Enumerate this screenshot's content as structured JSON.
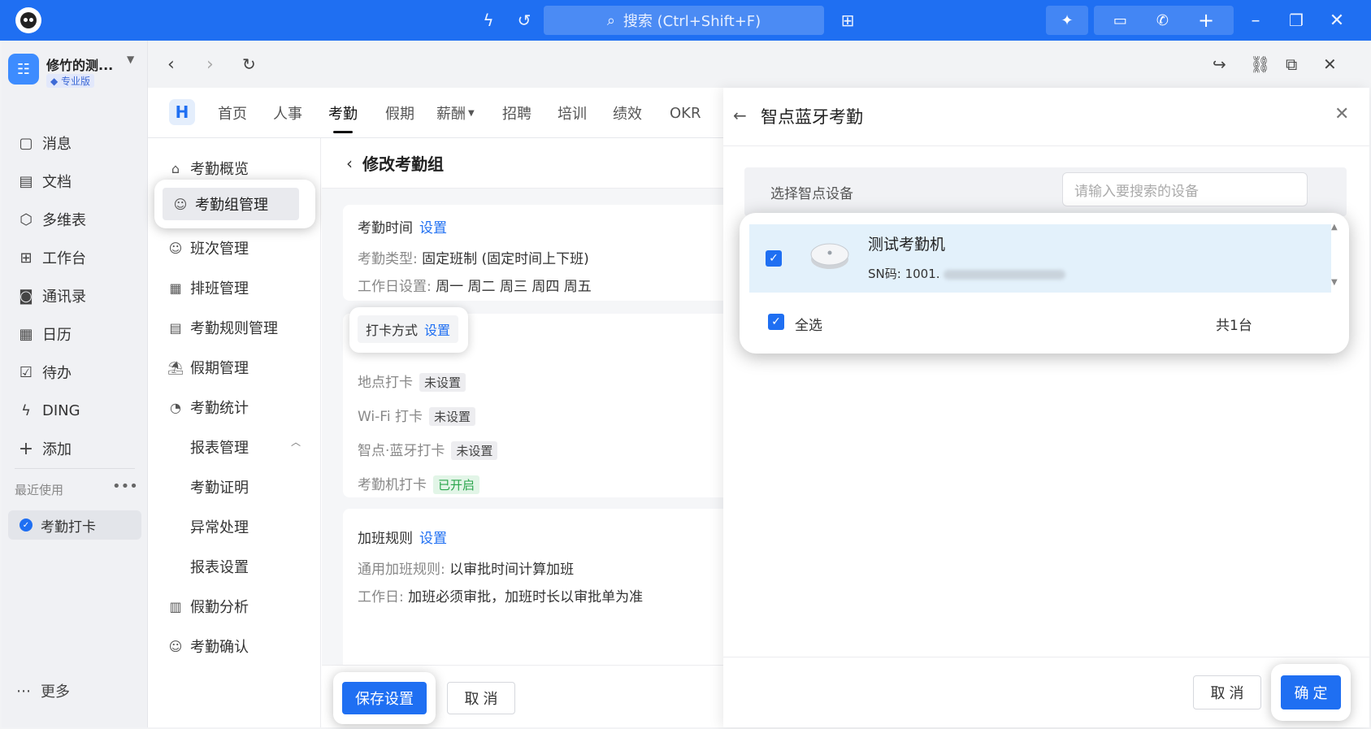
{
  "titlebar": {
    "search_placeholder": "搜索 (Ctrl+Shift+F)",
    "icons": [
      "logo-icon",
      "beta-bolt-icon",
      "history-icon",
      "search-icon",
      "apps-icon",
      "ai-icon",
      "screen-share-icon",
      "call-icon",
      "plus-icon",
      "minimize-icon",
      "restore-icon",
      "close-icon"
    ],
    "accent_color": "#1f6ff2"
  },
  "org": {
    "name": "修竹的测...",
    "badge": "专业版"
  },
  "sidebar": {
    "items": [
      {
        "label": "消息",
        "icon": "message-icon"
      },
      {
        "label": "文档",
        "icon": "document-icon"
      },
      {
        "label": "多维表",
        "icon": "cube-icon"
      },
      {
        "label": "工作台",
        "icon": "grid-icon"
      },
      {
        "label": "通讯录",
        "icon": "contacts-icon"
      },
      {
        "label": "日历",
        "icon": "calendar-icon"
      },
      {
        "label": "待办",
        "icon": "todo-icon"
      },
      {
        "label": "DING",
        "icon": "bolt-icon"
      },
      {
        "label": "添加",
        "icon": "plus-icon"
      }
    ],
    "recent_title": "最近使用",
    "recent_item": "考勤打卡",
    "more_label": "更多"
  },
  "module_tabs": [
    "首页",
    "人事",
    "考勤",
    "假期",
    "薪酬",
    "招聘",
    "培训",
    "绩效",
    "OKR"
  ],
  "active_tab": "考勤",
  "left_menu": {
    "items": [
      "考勤概览",
      "考勤组管理",
      "班次管理",
      "排班管理",
      "考勤规则管理",
      "假期管理",
      "考勤统计",
      "报表管理",
      "考勤证明",
      "异常处理",
      "报表设置",
      "假勤分析",
      "考勤确认"
    ],
    "selected": "考勤组管理"
  },
  "content": {
    "title": "修改考勤组",
    "set_link": "设置",
    "time_card": {
      "title": "考勤时间",
      "type_key": "考勤类型:",
      "type_val": "固定班制 (固定时间上下班)",
      "days_key": "工作日设置:",
      "days_val": "周一 周二 周三 周四 周五"
    },
    "punch_card": {
      "title": "打卡方式",
      "rows": [
        {
          "label": "地点打卡",
          "status": "未设置"
        },
        {
          "label": "Wi-Fi 打卡",
          "status": "未设置"
        },
        {
          "label": "智点·蓝牙打卡",
          "status": "未设置"
        },
        {
          "label": "考勤机打卡",
          "status": "已开启"
        }
      ]
    },
    "ot_card": {
      "title": "加班规则",
      "rule_key": "通用加班规则:",
      "rule_val": "以审批时间计算加班",
      "day_key": "工作日:",
      "day_val": "加班必须审批，加班时长以审批单为准"
    },
    "save_label": "保存设置",
    "cancel_label": "取 消"
  },
  "drawer": {
    "title": "智点蓝牙考勤",
    "select_label": "选择智点设备",
    "search_placeholder": "请输入要搜索的设备",
    "device": {
      "name": "测试考勤机",
      "sn": "SN码: 1001."
    },
    "select_all": "全选",
    "count": "共1台",
    "cancel_label": "取 消",
    "ok_label": "确 定"
  }
}
